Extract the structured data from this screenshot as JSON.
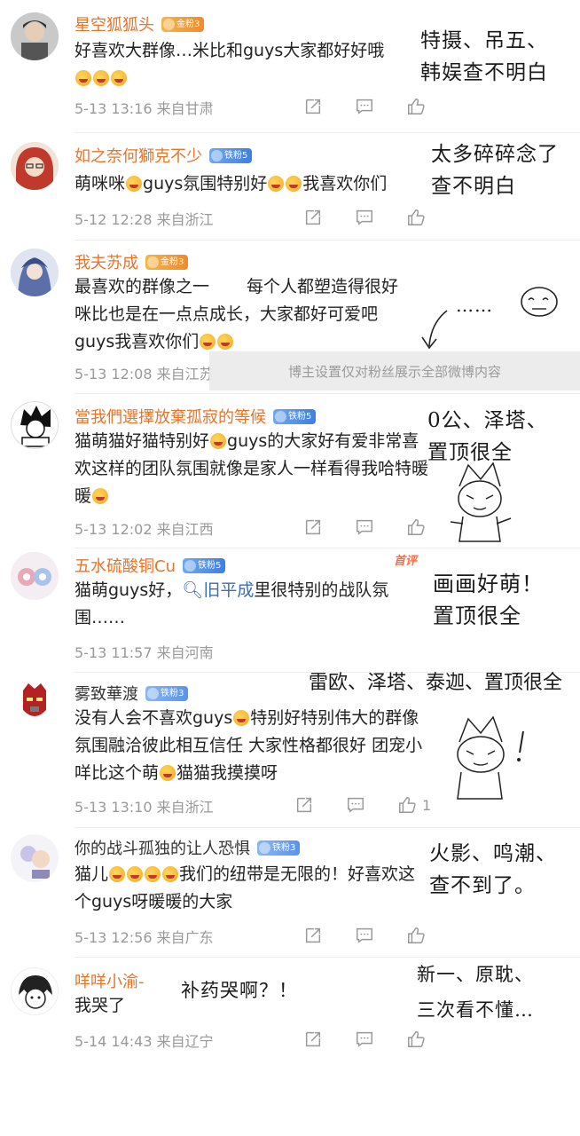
{
  "comments": [
    {
      "username": "星空狐狐头",
      "badge": "金粉3",
      "badge_type": "gold",
      "text": "好喜欢大群像…米比和guys大家都好好哦",
      "emoji_count": 3,
      "time": "5-13 13:16",
      "location": "来自甘肃",
      "likes": ""
    },
    {
      "username": "如之奈何獅克不少",
      "badge": "铁粉5",
      "badge_type": "iron",
      "text_a": "萌咪咪",
      "text_b": "guys氛围特别好",
      "text_c": "我喜欢你们",
      "time": "5-12 12:28",
      "location": "来自浙江",
      "likes": ""
    },
    {
      "username": "我夫苏成",
      "badge": "金粉3",
      "badge_type": "gold",
      "line1_a": "最喜欢的群像之一",
      "line1_b": "每个人都塑造得很好",
      "line2": "咪比也是在一点点成长，大家都好可爱吧",
      "line3": "guys我喜欢你们",
      "time": "5-13 12:08",
      "location": "来自江苏",
      "likes": ""
    },
    {
      "username": "當我們選擇放棄孤寂的等候",
      "badge": "铁粉5",
      "badge_type": "iron",
      "text_a": "猫萌猫好猫特别好",
      "text_b": "guys的大家好有爱非常喜欢这样的团队氛围就像是家人一样看得我哈特暖暖",
      "time": "5-13 12:02",
      "location": "来自江西",
      "likes": ""
    },
    {
      "username": "五水硫酸铜Cu",
      "badge": "铁粉5",
      "badge_type": "iron",
      "featured": "首评",
      "text_a": "猫萌guys好，",
      "topic": "旧平成",
      "text_b": "里很特别的战队氛围……",
      "time": "5-13 11:57",
      "location": "来自河南",
      "likes": ""
    },
    {
      "username": "雾致華渡",
      "badge": "铁粉3",
      "badge_type": "blue",
      "text_a": "没有人会不喜欢guys",
      "text_b": "特别好特别伟大的群像氛围融洽彼此相互信任 大家性格都很好 团宠小咩比这个萌",
      "text_c": "猫猫我摸摸呀",
      "time": "5-13 13:10",
      "location": "来自浙江",
      "likes": "1"
    },
    {
      "username": "你的战斗孤独的让人恐惧",
      "badge": "铁粉3",
      "badge_type": "blue",
      "text_a": "猫儿",
      "text_b": "我们的纽带是无限的！好喜欢这个guys呀暖暖的大家",
      "time": "5-13 12:56",
      "location": "来自广东",
      "likes": ""
    },
    {
      "username": "咩咩小渝-",
      "badge": "",
      "badge_type": "",
      "text": "我哭了",
      "time": "5-14 14:43",
      "location": "来自辽宁",
      "likes": ""
    }
  ],
  "notice": "博主设置仅对粉丝展示全部微博内容",
  "annotations": {
    "n1": "特摄、吊五、\n韩娱查不明白",
    "n2": "太多碎碎念了\n查不明白",
    "n3": "……",
    "n4": "0公、泽塔、\n置顶很全",
    "n5": "画画好萌！\n置顶很全",
    "n6": "雷欧、泽塔、泰迦、置顶很全",
    "n7": "火影、鸣潮、\n查不到了。",
    "n8": "新一、原耽、\n三次看不懂…",
    "n9": "补药哭啊？！"
  }
}
